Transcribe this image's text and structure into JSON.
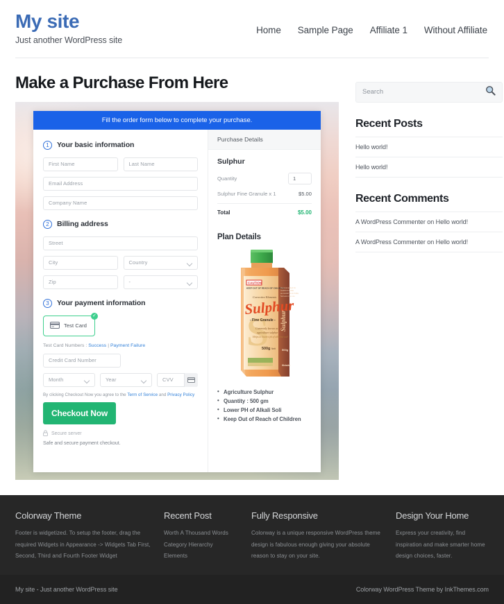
{
  "header": {
    "site_title": "My site",
    "tagline": "Just another WordPress site",
    "nav": [
      {
        "label": "Home"
      },
      {
        "label": "Sample Page"
      },
      {
        "label": "Affiliate 1"
      },
      {
        "label": "Without Affiliate"
      }
    ]
  },
  "main": {
    "page_title": "Make a Purchase From Here",
    "banner": "Fill the order form below to complete your purchase.",
    "steps": {
      "one_num": "1",
      "one_label": "Your basic information",
      "two_num": "2",
      "two_label": "Billing address",
      "three_num": "3",
      "three_label": "Your payment information"
    },
    "fields": {
      "first_name": "First Name",
      "last_name": "Last Name",
      "email": "Email Address",
      "company": "Company Name",
      "street": "Street",
      "city": "City",
      "country": "Country",
      "zip": "Zip",
      "state": "-",
      "card_number": "Credit Card Number",
      "month": "Month",
      "year": "Year",
      "cvv": "CVV"
    },
    "payment": {
      "test_card_label": "Test Card",
      "check_glyph": "✓",
      "test_numbers_prefix": "Test Card Numbers : ",
      "success_link": "Success",
      "separator": " | ",
      "failure_link": "Payment Failure",
      "agree_prefix": "By clicking Checkout Now you agree to the ",
      "terms_link": "Term of Service",
      "agree_mid": " and ",
      "privacy_link": "Privacy Policy",
      "checkout_label": "Checkout Now",
      "secure_server": "Secure server",
      "secure_note": "Safe and secure payment checkout."
    },
    "purchase_details": {
      "heading": "Purchase Details",
      "product": "Sulphur",
      "quantity_label": "Quantity",
      "quantity_value": "1",
      "line_item_label": "Sulphur Fine Granule x 1",
      "line_item_amount": "$5.00",
      "total_label": "Total",
      "total_amount": "$5.00"
    },
    "plan_details": {
      "heading": "Plan Details",
      "product_label": {
        "caution": "CAUTION",
        "caution_sub": "KEEP OUT OF REACH OF CHILDREN",
        "corrective": "Corrective Elements",
        "name": "Sulphur",
        "subtitle": "- Fine Granule -",
        "big_letter": "S",
        "desc_1": "Commonly known as",
        "desc_2": "agriculture sulphur",
        "desc_3": "Helps to lowers ph of alkaline soil",
        "weight": "500g",
        "weight_unit": "Nett",
        "side_name": "Sulphur"
      },
      "bullets": [
        "Agriculture Sulphur",
        "Quantity : 500 gm",
        "Lower PH of Alkali Soli",
        "Keep Out of Reach of Children"
      ]
    }
  },
  "sidebar": {
    "search_placeholder": "Search",
    "recent_posts_title": "Recent Posts",
    "recent_posts": [
      {
        "label": "Hello world!"
      },
      {
        "label": "Hello world!"
      }
    ],
    "recent_comments_title": "Recent Comments",
    "recent_comments": [
      {
        "label": "A WordPress Commenter on Hello world!"
      },
      {
        "label": "A WordPress Commenter on Hello world!"
      }
    ]
  },
  "footer": {
    "col1": {
      "title": "Colorway Theme",
      "body": "Footer is widgetized. To setup the footer, drag the required Widgets in Appearance -> Widgets Tab First, Second, Third and Fourth Footer Widget"
    },
    "col2": {
      "title": "Recent Post",
      "items": [
        {
          "label": "Worth A Thousand Words"
        },
        {
          "label": "Category Hierarchy"
        },
        {
          "label": "Elements"
        }
      ]
    },
    "col3": {
      "title": "Fully Responsive",
      "body": "Colorway is a unique responsive WordPress theme design is fabulous enough giving your absolute reason to stay on your site."
    },
    "col4": {
      "title": "Design Your Home",
      "body": "Express your creativity, find inspiration and make smarter home design choices, faster."
    },
    "copyright_left": "My site - Just another WordPress site",
    "copyright_right": "Colorway WordPress Theme by InkThemes.com"
  }
}
